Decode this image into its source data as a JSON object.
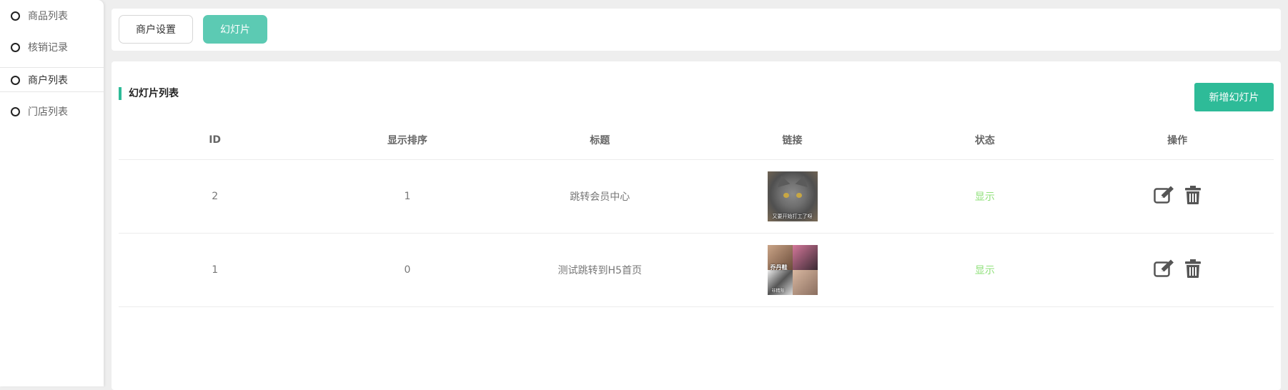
{
  "sidebar": {
    "items": [
      {
        "label": "商品列表"
      },
      {
        "label": "核销记录"
      },
      {
        "label": "商户列表"
      },
      {
        "label": "门店列表"
      }
    ]
  },
  "tabs": [
    {
      "label": "商户设置"
    },
    {
      "label": "幻灯片"
    }
  ],
  "section": {
    "title": "幻灯片列表",
    "add_button": "新增幻灯片"
  },
  "table": {
    "headers": [
      "ID",
      "显示排序",
      "标题",
      "链接",
      "状态",
      "操作"
    ],
    "rows": [
      {
        "id": "2",
        "sort": "1",
        "title": "跳转会员中心",
        "image_caption": "又要开始打工了呀",
        "status": "显示"
      },
      {
        "id": "1",
        "sort": "0",
        "title": "测试跳转到H5首页",
        "image_caption": "乔丹鞋",
        "image_caption2": "非精阳",
        "status": "显示"
      }
    ]
  },
  "colors": {
    "accent": "#2ebb98",
    "tab_active": "#5ccab3",
    "status_on": "#8fe07a"
  },
  "icons": [
    "edit-icon",
    "trash-icon"
  ]
}
